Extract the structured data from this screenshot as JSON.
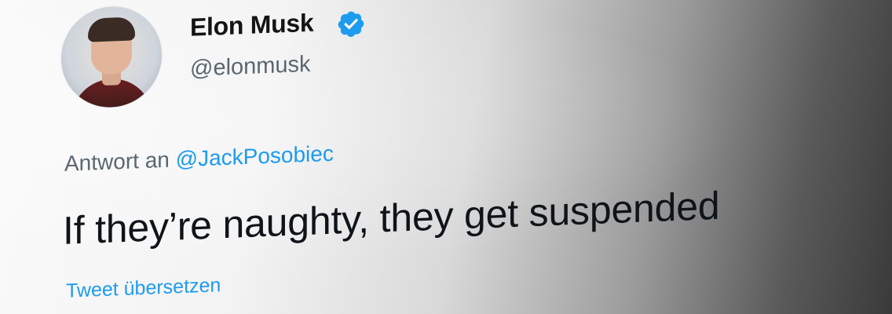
{
  "author": {
    "name": "Elon Musk",
    "handle": "@elonmusk",
    "verified_icon": "verified-badge-icon",
    "avatar": "profile-photo"
  },
  "reply": {
    "prefix": "Antwort an",
    "mention": "@JackPosobiec"
  },
  "tweet": {
    "text": "If they’re naughty, they get suspended",
    "translate_label": "Tweet übersetzen"
  },
  "colors": {
    "link": "#1d9bf0",
    "verified": "#1d9bf0",
    "text": "#0f1419",
    "secondary": "#5b6770"
  }
}
